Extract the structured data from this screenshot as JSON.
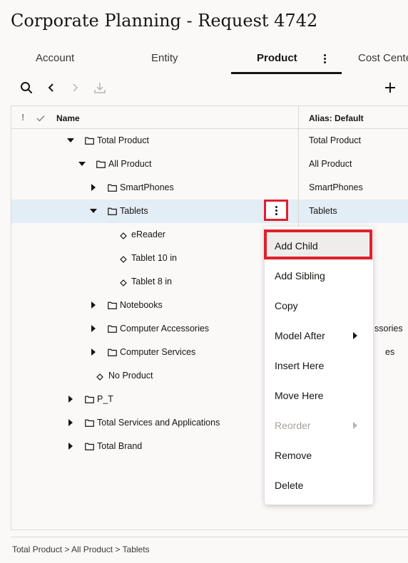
{
  "page": {
    "title": "Corporate Planning - Request 4742"
  },
  "tabs": [
    {
      "label": "Account",
      "active": false
    },
    {
      "label": "Entity",
      "active": false
    },
    {
      "label": "Product",
      "active": true
    },
    {
      "label": "Cost Cente",
      "active": false
    }
  ],
  "toolbar": {
    "buttons": [
      {
        "icon": "search-icon",
        "enabled": true
      },
      {
        "icon": "chevron-left-icon",
        "enabled": true
      },
      {
        "icon": "chevron-right-icon",
        "enabled": false
      },
      {
        "icon": "download-icon",
        "enabled": false
      },
      {
        "icon": "plus-icon",
        "enabled": true
      }
    ]
  },
  "tree": {
    "columns": {
      "status": "!",
      "name": "Name",
      "alias": "Alias: Default"
    },
    "rows": [
      {
        "label": "Total Product",
        "alias": "Total Product",
        "level": 0,
        "type": "folder",
        "expanded": true
      },
      {
        "label": "All Product",
        "alias": "All Product",
        "level": 1,
        "type": "folder",
        "expanded": true
      },
      {
        "label": "SmartPhones",
        "alias": "SmartPhones",
        "level": 2,
        "type": "folder",
        "expanded": false
      },
      {
        "label": "Tablets",
        "alias": "Tablets",
        "level": 2,
        "type": "folder",
        "expanded": true,
        "selected": true
      },
      {
        "label": "eReader",
        "alias": "",
        "level": 3,
        "type": "leaf"
      },
      {
        "label": "Tablet 10 in",
        "alias": "",
        "level": 3,
        "type": "leaf"
      },
      {
        "label": "Tablet 8 in",
        "alias": "",
        "level": 3,
        "type": "leaf"
      },
      {
        "label": "Notebooks",
        "alias": "",
        "level": 2,
        "type": "folder",
        "expanded": false
      },
      {
        "label": "Computer Accessories",
        "alias": "ssories",
        "level": 2,
        "type": "folder",
        "expanded": false
      },
      {
        "label": "Computer Services",
        "alias": "es",
        "level": 2,
        "type": "folder",
        "expanded": false
      },
      {
        "label": "No Product",
        "alias": "",
        "level": 1,
        "type": "leaf"
      },
      {
        "label": "P_T",
        "alias": "",
        "level": 0,
        "type": "folder",
        "expanded": false
      },
      {
        "label": "Total Services and Applications",
        "alias": "",
        "level": 0,
        "type": "folder",
        "expanded": false
      },
      {
        "label": "Total Brand",
        "alias": "",
        "level": 0,
        "type": "folder",
        "expanded": false
      }
    ]
  },
  "context_menu": {
    "items": [
      {
        "label": "Add Child",
        "enabled": true,
        "submenu": false,
        "highlighted": true
      },
      {
        "label": "Add Sibling",
        "enabled": true,
        "submenu": false
      },
      {
        "label": "Copy",
        "enabled": true,
        "submenu": false
      },
      {
        "label": "Model After",
        "enabled": true,
        "submenu": true
      },
      {
        "label": "Insert Here",
        "enabled": true,
        "submenu": false
      },
      {
        "label": "Move Here",
        "enabled": true,
        "submenu": false
      },
      {
        "label": "Reorder",
        "enabled": false,
        "submenu": true
      },
      {
        "label": "Remove",
        "enabled": true,
        "submenu": false
      },
      {
        "label": "Delete",
        "enabled": true,
        "submenu": false
      }
    ]
  },
  "status": {
    "breadcrumb": "Total Product > All Product > Tablets"
  },
  "colors": {
    "accent": "#161513",
    "selected_row": "#e3edf6",
    "highlight_outline": "#e0202d"
  }
}
